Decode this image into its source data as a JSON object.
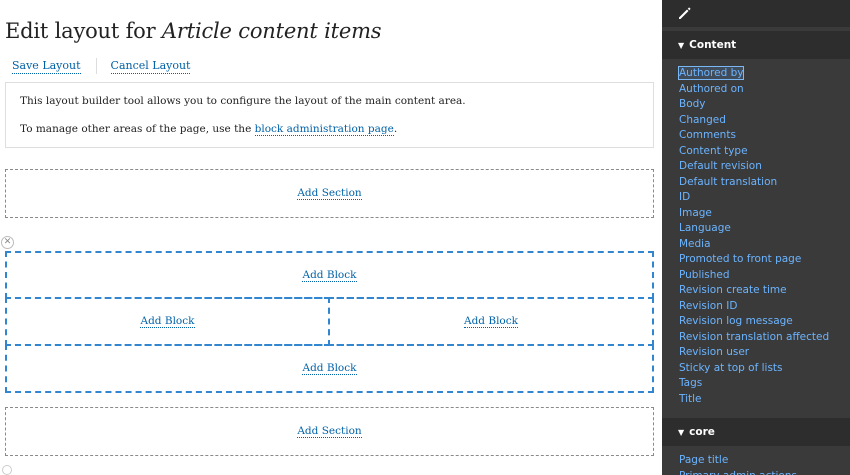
{
  "page": {
    "title_prefix": "Edit layout for ",
    "title_em": "Article content items"
  },
  "tabs": {
    "save_label": "Save Layout",
    "cancel_label": "Cancel Layout"
  },
  "info": {
    "line1": "This layout builder tool allows you to configure the layout of the main content area.",
    "line2_prefix": "To manage other areas of the page, use the ",
    "line2_link": "block administration page",
    "line2_suffix": "."
  },
  "layout": {
    "add_section_label": "Add Section",
    "add_block_label": "Add Block",
    "remove_section_icon": "close-icon"
  },
  "sidebar": {
    "edit_icon": "pencil-icon",
    "groups": [
      {
        "title": "Content",
        "items": [
          "Authored by",
          "Authored on",
          "Body",
          "Changed",
          "Comments",
          "Content type",
          "Default revision",
          "Default translation",
          "ID",
          "Image",
          "Language",
          "Media",
          "Promoted to front page",
          "Published",
          "Revision create time",
          "Revision ID",
          "Revision log message",
          "Revision translation affected",
          "Revision user",
          "Sticky at top of lists",
          "Tags",
          "Title"
        ]
      },
      {
        "title": "core",
        "items": [
          "Page title",
          "Primary admin actions"
        ]
      }
    ]
  },
  "colors": {
    "link": "#0062a8",
    "region_border": "#3286d0",
    "sidebar_bg": "#3a3a3a",
    "sidebar_header_bg": "#2d2d2d",
    "sidebar_link": "#6cb4ff"
  }
}
